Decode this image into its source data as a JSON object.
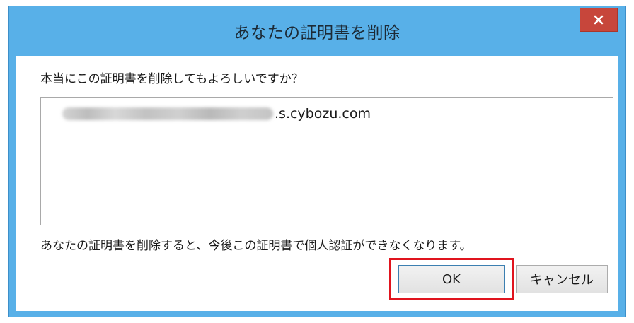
{
  "dialog": {
    "title": "あなたの証明書を削除",
    "close_icon": "close-icon",
    "question": "本当にこの証明書を削除してもよろしいですか？",
    "certificate": {
      "domain_suffix": ".s.cybozu.com"
    },
    "warning": "あなたの証明書を削除すると、今後この証明書で個人認証ができなくなります。",
    "buttons": {
      "ok_label": "OK",
      "cancel_label": "キャンセル"
    }
  },
  "colors": {
    "titlebar": "#58b0e8",
    "close_button": "#c7463b",
    "highlight_border": "#e0141e"
  }
}
